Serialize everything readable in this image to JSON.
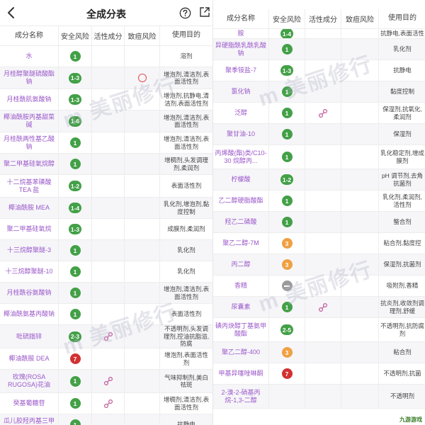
{
  "header": {
    "title": "全成分表"
  },
  "columns": [
    "成分名称",
    "安全风险",
    "活性成分",
    "致痘风险",
    "使用目的"
  ],
  "left_rows": [
    {
      "name": "水",
      "risk": "1",
      "level": "low",
      "active": false,
      "acne": false,
      "use": "溶剂"
    },
    {
      "name": "月桂醇聚醚硫酸酯钠",
      "risk": "1-3",
      "level": "low",
      "active": false,
      "acne": true,
      "use": "增泡剂,清洁剂,表面活性剂"
    },
    {
      "name": "月桂酰肌氨酸钠",
      "risk": "1-3",
      "level": "low",
      "active": false,
      "acne": false,
      "use": "增泡剂,抗静电,清洁剂,表面活性剂"
    },
    {
      "name": "椰油酰胺丙基甜菜碱",
      "risk": "1-6",
      "level": "low",
      "active": false,
      "acne": false,
      "use": "增泡剂,清洁剂,表面活性剂"
    },
    {
      "name": "月桂酰两性基乙酸钠",
      "risk": "1",
      "level": "low",
      "active": false,
      "acne": false,
      "use": "增泡剂,清洁剂,表面活性剂"
    },
    {
      "name": "聚二甲基硅氧烷醇",
      "risk": "1",
      "level": "low",
      "active": false,
      "acne": false,
      "use": "增稠剂,头发调理剂,柔润剂"
    },
    {
      "name": "十二烷基苯磺酸TEA 盐",
      "risk": "1-2",
      "level": "low",
      "active": false,
      "acne": false,
      "use": "表面活性剂"
    },
    {
      "name": "椰油酰胺 MEA",
      "risk": "1-4",
      "level": "low",
      "active": false,
      "acne": false,
      "use": "乳化剂,增泡剂,黏度控制"
    },
    {
      "name": "聚二甲基硅氧烷",
      "risk": "1-3",
      "level": "low",
      "active": false,
      "acne": false,
      "use": "成膜剂,柔润剂"
    },
    {
      "name": "十三烷醇聚醚-3",
      "risk": "1",
      "level": "low",
      "active": false,
      "acne": false,
      "use": "乳化剂"
    },
    {
      "name": "十三烷醇聚醚-10",
      "risk": "1",
      "level": "low",
      "active": false,
      "acne": false,
      "use": "乳化剂"
    },
    {
      "name": "月桂酰谷氨酸钠",
      "risk": "1",
      "level": "low",
      "active": false,
      "acne": false,
      "use": "增泡剂,清洁剂,表面活性剂"
    },
    {
      "name": "椰油酰氨基丙酸钠",
      "risk": "1",
      "level": "low",
      "active": false,
      "acne": false,
      "use": "表面活性剂"
    },
    {
      "name": "吡硫鎓锌",
      "risk": "2-3",
      "level": "low",
      "active": true,
      "acne": false,
      "use": "不透明剂,头发调理剂,控油抗脂溢,防腐"
    },
    {
      "name": "椰油酰胺 DEA",
      "risk": "7",
      "level": "high",
      "active": false,
      "acne": false,
      "use": "增泡剂,表面活性剂"
    },
    {
      "name": "玫瑰(ROSA RUGOSA)花油",
      "risk": "1",
      "level": "low",
      "active": true,
      "acne": false,
      "use": "气味抑制剂,美白祛斑"
    },
    {
      "name": "癸基葡糖苷",
      "risk": "1",
      "level": "low",
      "active": true,
      "acne": false,
      "use": "增稠剂,清洁剂,表面活性剂"
    },
    {
      "name": "瓜儿胶羟丙基三甲基氯化铵",
      "risk": "1",
      "level": "low",
      "active": false,
      "acne": false,
      "use": "抗静电"
    }
  ],
  "right_rows": [
    {
      "name": "胺",
      "risk": "1-4",
      "level": "low",
      "active": false,
      "acne": false,
      "use": "抗静电,表面活性"
    },
    {
      "name": "异硬脂酰乳酰乳酸钠",
      "risk": "1",
      "level": "low",
      "active": false,
      "acne": false,
      "use": "乳化剂"
    },
    {
      "name": "聚季铵盐-7",
      "risk": "1-3",
      "level": "low",
      "active": false,
      "acne": false,
      "use": "抗静电"
    },
    {
      "name": "氯化钠",
      "risk": "1",
      "level": "low",
      "active": false,
      "acne": false,
      "use": "黏度控制"
    },
    {
      "name": "泛醇",
      "risk": "1",
      "level": "low",
      "active": true,
      "acne": false,
      "use": "保湿剂,抗氧化,柔润剂"
    },
    {
      "name": "聚甘油-10",
      "risk": "1",
      "level": "low",
      "active": false,
      "acne": false,
      "use": "保湿剂"
    },
    {
      "name": "丙烯酸(酯)类/C10-30 烷醇丙...",
      "risk": "1",
      "level": "low",
      "active": false,
      "acne": false,
      "use": "乳化稳定剂,增成膜剂"
    },
    {
      "name": "柠檬酸",
      "risk": "1-2",
      "level": "low",
      "active": false,
      "acne": false,
      "use": "pH 调节剂,去角抗菌剂"
    },
    {
      "name": "乙二醇硬脂酸酯",
      "risk": "1",
      "level": "low",
      "active": false,
      "acne": false,
      "use": "乳化剂,柔润剂,活性剂"
    },
    {
      "name": "羟乙二磷酸",
      "risk": "1",
      "level": "low",
      "active": false,
      "acne": false,
      "use": "螯合剂"
    },
    {
      "name": "聚乙二醇-7M",
      "risk": "3",
      "level": "mid",
      "active": false,
      "acne": false,
      "use": "粘合剂,黏度控"
    },
    {
      "name": "丙二醇",
      "risk": "3",
      "level": "mid",
      "active": false,
      "acne": false,
      "use": "保湿剂,抗菌剂"
    },
    {
      "name": "香精",
      "risk": "",
      "level": "unknown",
      "active": false,
      "acne": false,
      "use": "吸附剂,香精"
    },
    {
      "name": "尿囊素",
      "risk": "1",
      "level": "low",
      "active": true,
      "acne": false,
      "use": "抗炎剂,收敛剂调理剂,舒缓"
    },
    {
      "name": "碘丙炔醇丁基氨甲酸酯",
      "risk": "2-5",
      "level": "low",
      "active": false,
      "acne": false,
      "use": "不透明剂,抗防腐剂"
    },
    {
      "name": "聚乙二醇-400",
      "risk": "3",
      "level": "mid",
      "active": false,
      "acne": false,
      "use": "粘合剂"
    },
    {
      "name": "甲基异噻唑啉酮",
      "risk": "7",
      "level": "high",
      "active": false,
      "acne": false,
      "use": "不透明剂,抗菌"
    },
    {
      "name": "2-溴-2-硝基丙烷-1,3-二醇",
      "risk": "",
      "level": "none",
      "active": false,
      "acne": false,
      "use": "不透明剂"
    }
  ],
  "footer": {
    "logo_text": "九游游戏"
  }
}
